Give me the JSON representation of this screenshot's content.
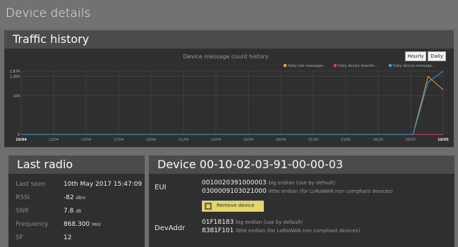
{
  "page": {
    "title": "Device details"
  },
  "traffic": {
    "title": "Traffic history",
    "buttons": {
      "hourly": "Hourly",
      "daily": "Daily"
    }
  },
  "chart_data": {
    "type": "line",
    "title": "Device message count history",
    "y_scale": "log",
    "ylim": [
      0,
      1874
    ],
    "y_ticks": [
      "1,874",
      "1,000",
      "100",
      "0"
    ],
    "x_labels": [
      "10/04",
      "12/04",
      "14/04",
      "17/04",
      "19/04",
      "21/04",
      "24/04",
      "26/04",
      "28/04",
      "01/05",
      "03/05",
      "06/05",
      "08/05",
      "10/05"
    ],
    "x_first_label": "10/04",
    "x_last_label": "10/05",
    "legend_position": "top-right",
    "series": [
      {
        "name": "Daily lost messages",
        "color": "#e8a735",
        "values": [
          0,
          0,
          0,
          0,
          0,
          0,
          0,
          0,
          0,
          0,
          0,
          0,
          0,
          0,
          0,
          0,
          0,
          0,
          0,
          0,
          0,
          0,
          0,
          0,
          0,
          0,
          0,
          1000,
          200
        ]
      },
      {
        "name": "Daily device downlin...",
        "color": "#e0388a",
        "values": [
          0,
          0,
          0,
          0,
          0,
          0,
          0,
          0,
          0,
          0,
          0,
          0,
          0,
          0,
          0,
          0,
          0,
          0,
          0,
          0,
          0,
          0,
          0,
          0,
          0,
          0,
          0,
          0,
          0
        ]
      },
      {
        "name": "Daily device message...",
        "color": "#3b9ddf",
        "values": [
          0,
          0,
          0,
          0,
          0,
          0,
          0,
          0,
          0,
          0,
          0,
          0,
          0,
          0,
          0,
          0,
          0,
          0,
          0,
          0,
          0,
          0,
          0,
          0,
          0,
          0,
          0,
          500,
          1874
        ]
      }
    ],
    "grid": true
  },
  "last_radio": {
    "title": "Last radio",
    "rows": [
      {
        "key": "Last seen",
        "value": "10th May 2017 15:47:09",
        "unit": ""
      },
      {
        "key": "RSSI",
        "value": "-82",
        "unit": "dBm"
      },
      {
        "key": "SNR",
        "value": "7.8",
        "unit": "dB"
      },
      {
        "key": "Frequency",
        "value": "868.300",
        "unit": "MHz"
      },
      {
        "key": "SF",
        "value": "12",
        "unit": ""
      }
    ]
  },
  "device": {
    "title": "Device 00-10-02-03-91-00-00-03",
    "eui_label": "EUI",
    "eui_be": "0010020391000003",
    "eui_be_note": "big endian (use by default)",
    "eui_le": "0300009103021000",
    "eui_le_note": "little endian (for LoRaWAN non compliant devices)",
    "remove_label": "Remove device",
    "devaddr_label": "DevAddr",
    "devaddr_be": "01F18183",
    "devaddr_be_note": "big endian (use by default)",
    "devaddr_le": "8381F101",
    "devaddr_le_note": "little endian (for LoRaWAN non compliant devices)"
  }
}
